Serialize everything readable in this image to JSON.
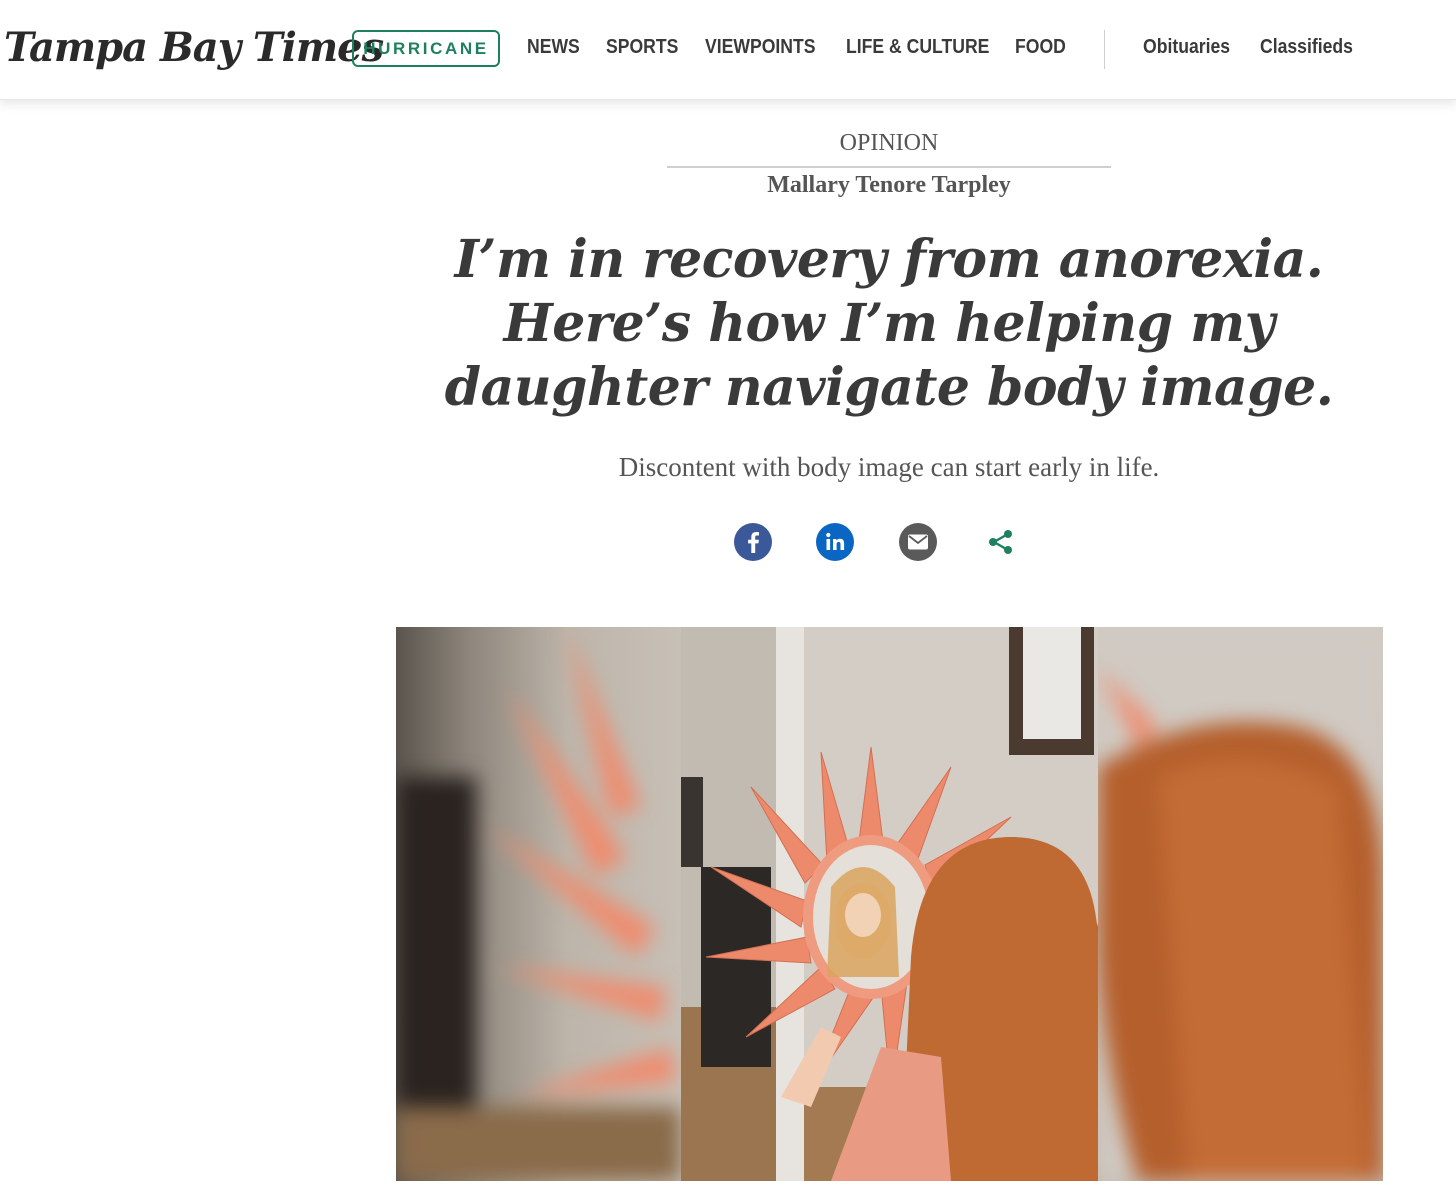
{
  "site": {
    "logo": "Tampa Bay Times"
  },
  "nav": {
    "badge": "HURRICANE",
    "items": [
      "NEWS",
      "SPORTS",
      "VIEWPOINTS",
      "LIFE & CULTURE",
      "FOOD"
    ],
    "secondary": [
      "Obituaries",
      "Classifieds"
    ]
  },
  "article": {
    "section": "OPINION",
    "author": "Mallary Tenore Tarpley",
    "headline_lines": [
      "I’m in recovery from anorexia.",
      "Here’s how I’m helping my",
      "daughter navigate body image."
    ],
    "dek": "Discontent with body image can start early in life."
  },
  "share": {
    "icons": [
      "facebook-icon",
      "linkedin-icon",
      "email-icon",
      "share-icon"
    ],
    "colors": {
      "facebook": "#3b5998",
      "linkedin": "#0a66c2",
      "email": "#5a5a5a",
      "share": "#1e8060"
    }
  },
  "colors": {
    "brand_green": "#1e8060",
    "text_dark": "#3a3a3a",
    "text_gray": "#555555"
  }
}
